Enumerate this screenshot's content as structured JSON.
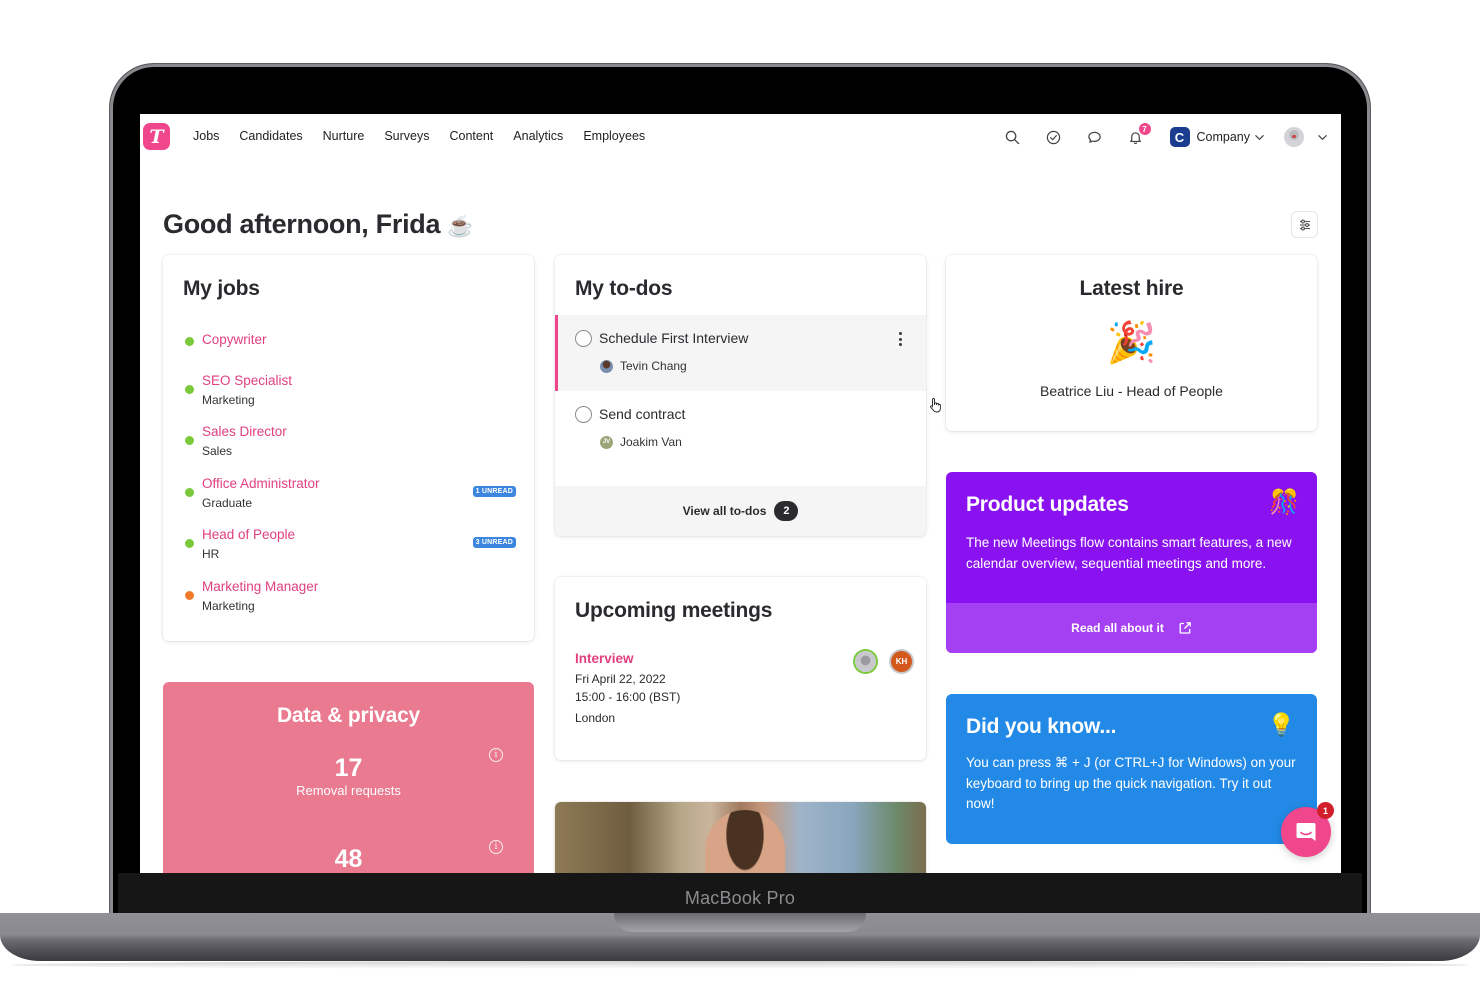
{
  "device": {
    "label": "MacBook Pro"
  },
  "app": {
    "logo_letter": "T",
    "brand_color": "#f0468b"
  },
  "nav": {
    "links": [
      "Jobs",
      "Candidates",
      "Nurture",
      "Surveys",
      "Content",
      "Analytics",
      "Employees"
    ],
    "notifications_count": "7",
    "company_initial": "C",
    "company_name": "Company"
  },
  "greeting": {
    "text": "Good afternoon, Frida",
    "emoji": "☕"
  },
  "my_jobs": {
    "title": "My jobs",
    "items": [
      {
        "title": "Copywriter",
        "subtitle": "",
        "status_color": "#7ac93b",
        "badge": ""
      },
      {
        "title": "SEO Specialist",
        "subtitle": "Marketing",
        "status_color": "#7ac93b",
        "badge": ""
      },
      {
        "title": "Sales Director",
        "subtitle": "Sales",
        "status_color": "#7ac93b",
        "badge": ""
      },
      {
        "title": "Office Administrator",
        "subtitle": "Graduate",
        "status_color": "#7ac93b",
        "badge": "1 UNREAD"
      },
      {
        "title": "Head of People",
        "subtitle": "HR",
        "status_color": "#7ac93b",
        "badge": "3 UNREAD"
      },
      {
        "title": "Marketing Manager",
        "subtitle": "Marketing",
        "status_color": "#f07a2a",
        "badge": ""
      }
    ]
  },
  "data_privacy": {
    "title": "Data & privacy",
    "stats": [
      {
        "value": "17",
        "label": "Removal requests"
      },
      {
        "value": "48",
        "label": ""
      }
    ],
    "color": "#e97a90"
  },
  "todos": {
    "title": "My to-dos",
    "items": [
      {
        "title": "Schedule First Interview",
        "assignee": "Tevin Chang",
        "assignee_initials": "",
        "active": true
      },
      {
        "title": "Send contract",
        "assignee": "Joakim Van",
        "assignee_initials": "JV",
        "active": false
      }
    ],
    "view_all_label": "View all to-dos",
    "count": "2"
  },
  "meetings": {
    "title": "Upcoming meetings",
    "items": [
      {
        "type": "Interview",
        "date": "Fri April 22, 2022",
        "time": "15:00 - 16:00 (BST)",
        "location": "London",
        "attendees": [
          "",
          "KH"
        ]
      }
    ]
  },
  "latest_hire": {
    "title": "Latest hire",
    "emoji": "🎉",
    "text": "Beatrice Liu - Head of People"
  },
  "product_updates": {
    "title": "Product updates",
    "emoji": "🎊",
    "body": "The new Meetings flow contains smart features, a new calendar overview, sequential meetings and more.",
    "link_label": "Read all about it",
    "color": "#8a12f0"
  },
  "did_you_know": {
    "title": "Did you know...",
    "emoji": "💡",
    "body": "You can press ⌘ + J (or CTRL+J for Windows) on your keyboard to bring up the quick navigation. Try it out now!",
    "color": "#228ae6"
  },
  "chat": {
    "unread": "1"
  }
}
